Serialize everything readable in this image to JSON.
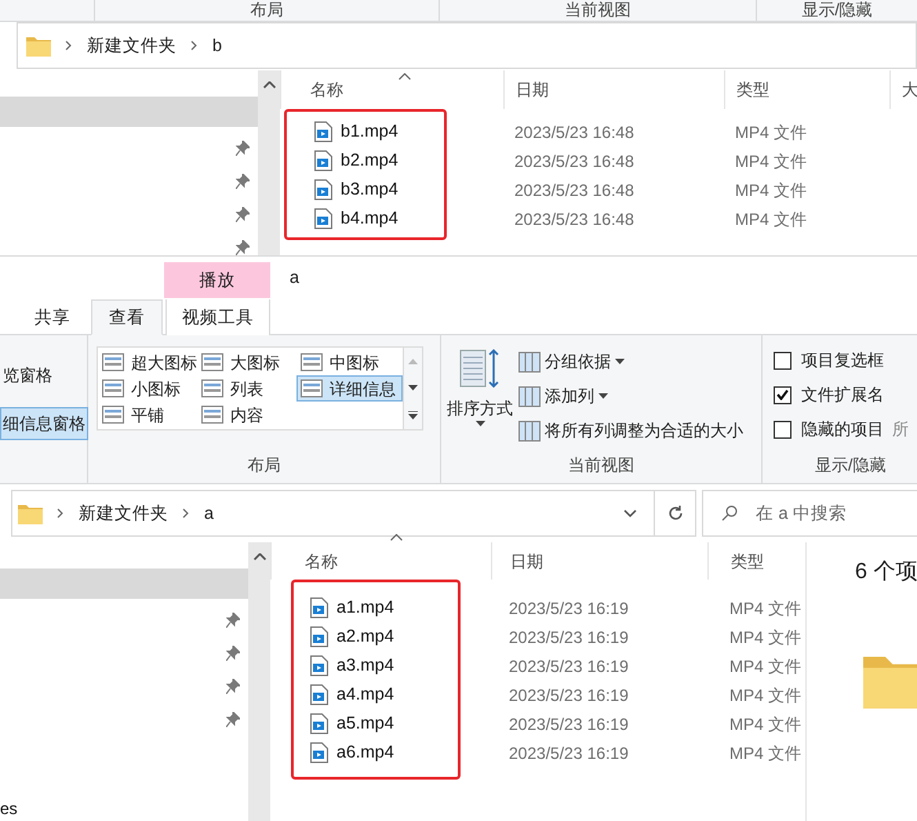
{
  "window_b": {
    "ribbon_groups": [
      "布局",
      "当前视图",
      "显示/隐藏"
    ],
    "breadcrumb": [
      "新建文件夹",
      "b"
    ],
    "columns": [
      "名称",
      "日期",
      "类型",
      "大"
    ],
    "files": [
      {
        "name": "b1.mp4",
        "date": "2023/5/23 16:48",
        "type": "MP4 文件"
      },
      {
        "name": "b2.mp4",
        "date": "2023/5/23 16:48",
        "type": "MP4 文件"
      },
      {
        "name": "b3.mp4",
        "date": "2023/5/23 16:48",
        "type": "MP4 文件"
      },
      {
        "name": "b4.mp4",
        "date": "2023/5/23 16:48",
        "type": "MP4 文件"
      }
    ]
  },
  "window_a": {
    "context_tab": "播放",
    "title": "a",
    "tabs": [
      {
        "label": "共享",
        "selected": false
      },
      {
        "label": "查看",
        "selected": true
      },
      {
        "label": "视频工具",
        "selected": false
      }
    ],
    "panes": [
      {
        "label": "览窗格",
        "selected": false
      },
      {
        "label": "细信息窗格",
        "selected": true
      }
    ],
    "layout_options": [
      {
        "label": "超大图标",
        "selected": false
      },
      {
        "label": "大图标",
        "selected": false
      },
      {
        "label": "中图标",
        "selected": false
      },
      {
        "label": "小图标",
        "selected": false
      },
      {
        "label": "列表",
        "selected": false
      },
      {
        "label": "详细信息",
        "selected": true
      },
      {
        "label": "平铺",
        "selected": false
      },
      {
        "label": "内容",
        "selected": false
      }
    ],
    "sort_button": "排序方式",
    "view_commands": [
      {
        "label": "分组依据",
        "dropdown": true
      },
      {
        "label": "添加列",
        "dropdown": true
      },
      {
        "label": "将所有列调整为合适的大小",
        "dropdown": false
      }
    ],
    "checkboxes": [
      {
        "label": "项目复选框",
        "checked": false
      },
      {
        "label": "文件扩展名",
        "checked": true
      },
      {
        "label": "隐藏的项目",
        "checked": false
      }
    ],
    "cut_label": "所",
    "ribbon_groups": [
      "布局",
      "当前视图",
      "显示/隐藏"
    ],
    "breadcrumb": [
      "新建文件夹",
      "a"
    ],
    "search": {
      "placeholder": "在 a 中搜索"
    },
    "columns": [
      "名称",
      "日期",
      "类型"
    ],
    "files": [
      {
        "name": "a1.mp4",
        "date": "2023/5/23 16:19",
        "type": "MP4 文件"
      },
      {
        "name": "a2.mp4",
        "date": "2023/5/23 16:19",
        "type": "MP4 文件"
      },
      {
        "name": "a3.mp4",
        "date": "2023/5/23 16:19",
        "type": "MP4 文件"
      },
      {
        "name": "a4.mp4",
        "date": "2023/5/23 16:19",
        "type": "MP4 文件"
      },
      {
        "name": "a5.mp4",
        "date": "2023/5/23 16:19",
        "type": "MP4 文件"
      },
      {
        "name": "a6.mp4",
        "date": "2023/5/23 16:19",
        "type": "MP4 文件"
      }
    ],
    "details": "6 个项",
    "nav_item": "es"
  }
}
